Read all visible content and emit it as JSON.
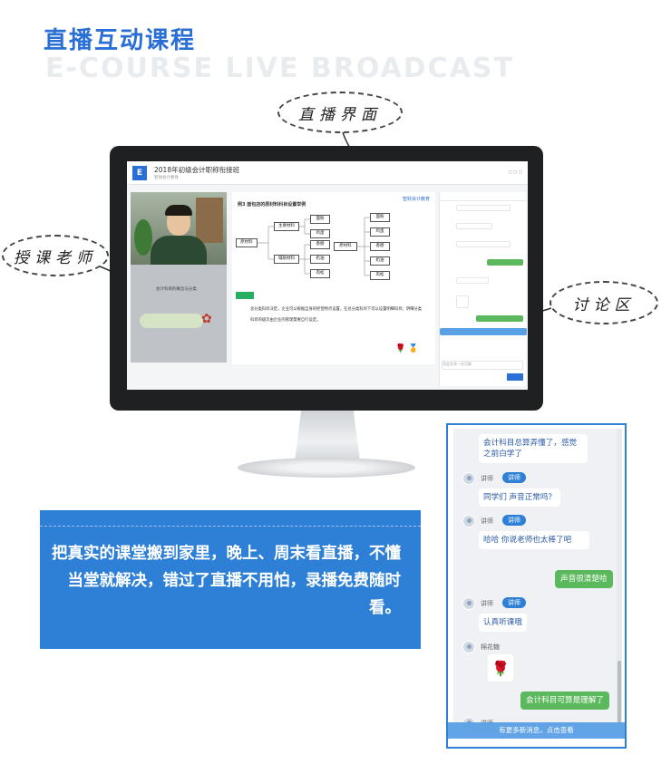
{
  "header": {
    "title_cn": "直播互动课程",
    "title_en": "E-COURSE LIVE BROADCAST"
  },
  "callouts": {
    "live_ui": "直播界面",
    "teacher": "授课老师",
    "discussion": "讨论区"
  },
  "screen": {
    "app_title": "2018年初级会计职称衔接班",
    "brand": "智财会计教育",
    "board_heading": "例3 面包店的原材料科目设置举例",
    "tree": {
      "root": "原材料",
      "group1": "主要材料",
      "group2": "辅助材料",
      "leaves_left": [
        "面粉",
        "鸡蛋",
        "香肠",
        "奶油",
        "肉松"
      ],
      "root2": "原材料",
      "leaves_right": [
        "面粉",
        "鸡蛋",
        "香肠",
        "奶油",
        "肉松"
      ]
    },
    "board_text": "总分类科目决定，企业可以根据自身的经营特点设置，在总分类科目下可以设置明细科目；明细分类科目的级次由企业的管理需要自行设定。",
    "left_panel_text": "会计科目的概念与分类",
    "chat_input_placeholder": "用此发表一些见解",
    "send_label": "发送"
  },
  "banner": {
    "text": "把真实的课堂搬到家里，晚上、周末看直播，不懂当堂就解决，错过了直播不用怕，录播免费随时看。"
  },
  "chat": {
    "messages": [
      {
        "text": "会计科目总算弄懂了，感觉之前白学了"
      },
      {
        "user": "讲师",
        "tag": "讲师",
        "text": "同学们 声音正常吗？"
      },
      {
        "user": "讲师",
        "tag": "讲师",
        "text": "哈哈 你说老师也太棒了吧"
      },
      {
        "self": "声音很清楚哈"
      },
      {
        "user": "讲师",
        "tag": "讲师",
        "text": "认真听课哦"
      },
      {
        "user": "棉花糖",
        "rose": "🌹"
      },
      {
        "self": "会计科目可算是理解了"
      }
    ],
    "partial_user": "讲师",
    "more_bar": "有更多新消息，点击查看"
  }
}
